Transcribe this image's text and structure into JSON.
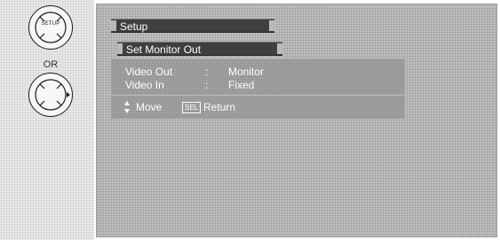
{
  "remote": {
    "top_dial_label": "SETUP",
    "or_label": "OR"
  },
  "osd": {
    "menu_title": "Setup",
    "submenu_title": "Set Monitor Out",
    "settings": [
      {
        "label": "Video Out",
        "separator": ":",
        "value": "Monitor"
      },
      {
        "label": "Video In",
        "separator": ":",
        "value": "Fixed"
      }
    ],
    "guide": {
      "move_label": "Move",
      "sel_key": "SEL",
      "return_label": "Return"
    }
  }
}
